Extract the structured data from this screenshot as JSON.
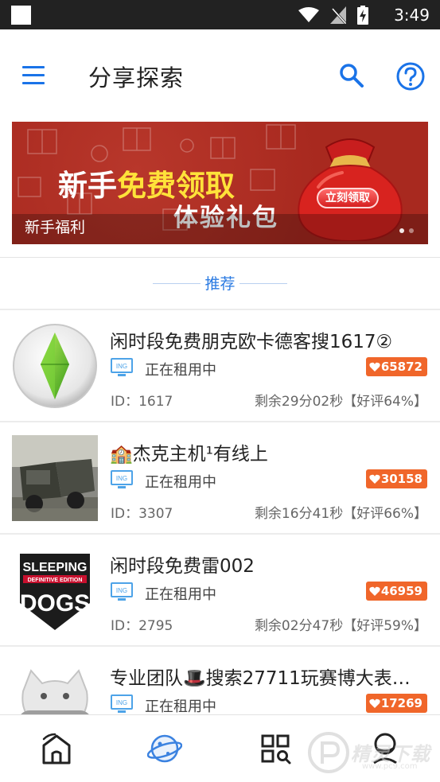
{
  "status_bar": {
    "time": "3:49",
    "icons": [
      "wifi-icon",
      "no-signal-icon",
      "battery-charging-icon"
    ]
  },
  "header": {
    "title": "分享探索",
    "icons": [
      "menu-icon",
      "search-icon",
      "help-icon"
    ]
  },
  "banner": {
    "line1_prefix": "新手",
    "line1_highlight": "免费领取",
    "line2": "体验礼包",
    "button_label": "立刻领取",
    "caption": "新手福利",
    "colors": {
      "background": "#a8291f",
      "highlight": "#ffe23a"
    }
  },
  "section": {
    "title": "推荐"
  },
  "listings": [
    {
      "title": "闲时段免费朋克欧卡德客搜1617②",
      "status": "正在租用中",
      "likes": "65872",
      "id_text": "ID：1617",
      "remaining": "剩余29分02秒【好评64%】",
      "status_tag": "ING",
      "thumb_icon": "sims-plumbob-icon"
    },
    {
      "title": "🏫杰克主机¹有线上",
      "status": "正在租用中",
      "likes": "30158",
      "id_text": "ID：3307",
      "remaining": "剩余16分41秒【好评66%】",
      "status_tag": "ING",
      "thumb_icon": "military-truck-image"
    },
    {
      "title": "闲时段免费雷002",
      "status": "正在租用中",
      "likes": "46959",
      "id_text": "ID：2795",
      "remaining": "剩余02分47秒【好评59%】",
      "status_tag": "ING",
      "thumb_icon": "sleeping-dogs-logo"
    },
    {
      "title": "专业团队🎩搜索27711玩赛博大表…",
      "status": "正在租用中",
      "likes": "17269",
      "id_text": "",
      "remaining": "",
      "status_tag": "ING",
      "thumb_icon": "cat-mascot-icon"
    }
  ],
  "thumb_logo": {
    "line1": "SLEEPING",
    "line2": "DEFINITIVE EDITION",
    "line3": "DOGS"
  },
  "bottom_nav": {
    "items": [
      "home-icon",
      "explore-planet-icon",
      "apps-grid-icon",
      "profile-icon"
    ],
    "active_index": 1
  },
  "watermark": {
    "text": "精灵下载",
    "sub": "www.pc9.com"
  },
  "colors": {
    "accent": "#1a73e8",
    "badge": "#f0662a",
    "section_title": "#2a7ae2"
  }
}
